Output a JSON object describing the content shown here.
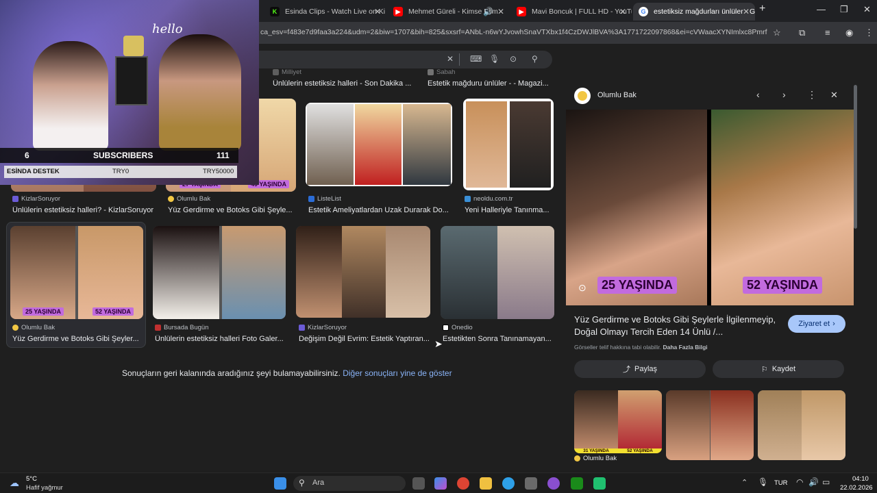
{
  "tabs": [
    {
      "title": "Esinda Clips - Watch Live on Ki",
      "icon": "kick-icon",
      "color": "#53fc18"
    },
    {
      "title": "Mehmet Güreli - Kimse Bilm",
      "icon": "youtube-icon",
      "color": "#ff0000"
    },
    {
      "title": "Mavi Boncuk | FULL HD - YouTu",
      "icon": "youtube-icon",
      "color": "#ff0000"
    },
    {
      "title": "estetiksiz mağdurları ünlüler - G",
      "icon": "google-icon",
      "color": "#ffffff"
    }
  ],
  "address": {
    "url": "ca_esv=f483e7d9faa3a224&udm=2&biw=1707&bih=825&sxsrf=ANbL-n6wYJvowhSnaVTXbx1f4CzDWJlBVA%3A1771722097868&ei=cVWaacXYNImlxc8Pmrfp..."
  },
  "profile_initial": "E",
  "results": {
    "row0": [
      {
        "source": "Milliyet",
        "title": "Ünlülerin estetiksiz halleri - Son Dakika ..."
      },
      {
        "source": "Sabah",
        "title": "Estetik mağduru ünlüler - - Magazi..."
      }
    ],
    "row1": [
      {
        "source": "KizlarSoruyor",
        "title": "Ünlülerin estetiksiz halleri? - KizlarSoruyor",
        "badges": []
      },
      {
        "source": "Olumlu Bak",
        "title": "Yüz Gerdirme ve Botoks Gibi Şeyle...",
        "badges": [
          "27 YAŞINDA",
          "49 YAŞINDA"
        ]
      },
      {
        "source": "ListeList",
        "title": "Estetik Ameliyatlardan Uzak Durarak Do..."
      },
      {
        "source": "neoldu.com.tr",
        "title": "Yeni Halleriyle Tanınma..."
      }
    ],
    "row2": [
      {
        "source": "Olumlu Bak",
        "title": "Yüz Gerdirme ve Botoks Gibi Şeyler...",
        "badges": [
          "25 YAŞINDA",
          "52 YAŞINDA"
        ]
      },
      {
        "source": "Bursada Bugün",
        "title": "Ünlülerin estetiksiz halleri Foto Galer..."
      },
      {
        "source": "KizlarSoruyor",
        "title": "Değişim Değil Evrim: Estetik Yaptıran..."
      },
      {
        "source": "Onedio",
        "title": "Estetikten Sonra Tanınamayan..."
      }
    ]
  },
  "end_message": {
    "text": "Sonuçların geri kalanında aradığınız şeyi bulamayabilirsiniz.",
    "link": "Diğer sonuçları yine de göster"
  },
  "panel": {
    "source": "Olumlu Bak",
    "badge_left": "25 YAŞINDA",
    "badge_right": "52 YAŞINDA",
    "title": "Yüz Gerdirme ve Botoks Gibi Şeylerle İlgilenmeyip, Doğal Olmayı Tercih Eden 14 Ünlü /...",
    "visit_label": "Ziyaret et",
    "copyright": "Görseller telif hakkına tabi olabilir.",
    "more_info": "Daha Fazla Bilgi",
    "share_label": "Paylaş",
    "save_label": "Kaydet",
    "related_badges": [
      "31 YAŞINDA",
      "52 YAŞINDA"
    ],
    "related_source": "Olumlu Bak"
  },
  "overlay": {
    "subscribers_count": "6",
    "subscribers_label": "SUBSCRIBERS",
    "subscribers_goal": "111",
    "donate_label": "ESİNDA DESTEK",
    "donate_current": "TRY0",
    "donate_goal": "TRY50000",
    "sign": "hello"
  },
  "taskbar": {
    "weather_temp": "5°C",
    "weather_desc": "Hafif yağmur",
    "search_label": "Ara",
    "lang": "TUR",
    "time": "04:10",
    "date": "22.02.2026"
  }
}
